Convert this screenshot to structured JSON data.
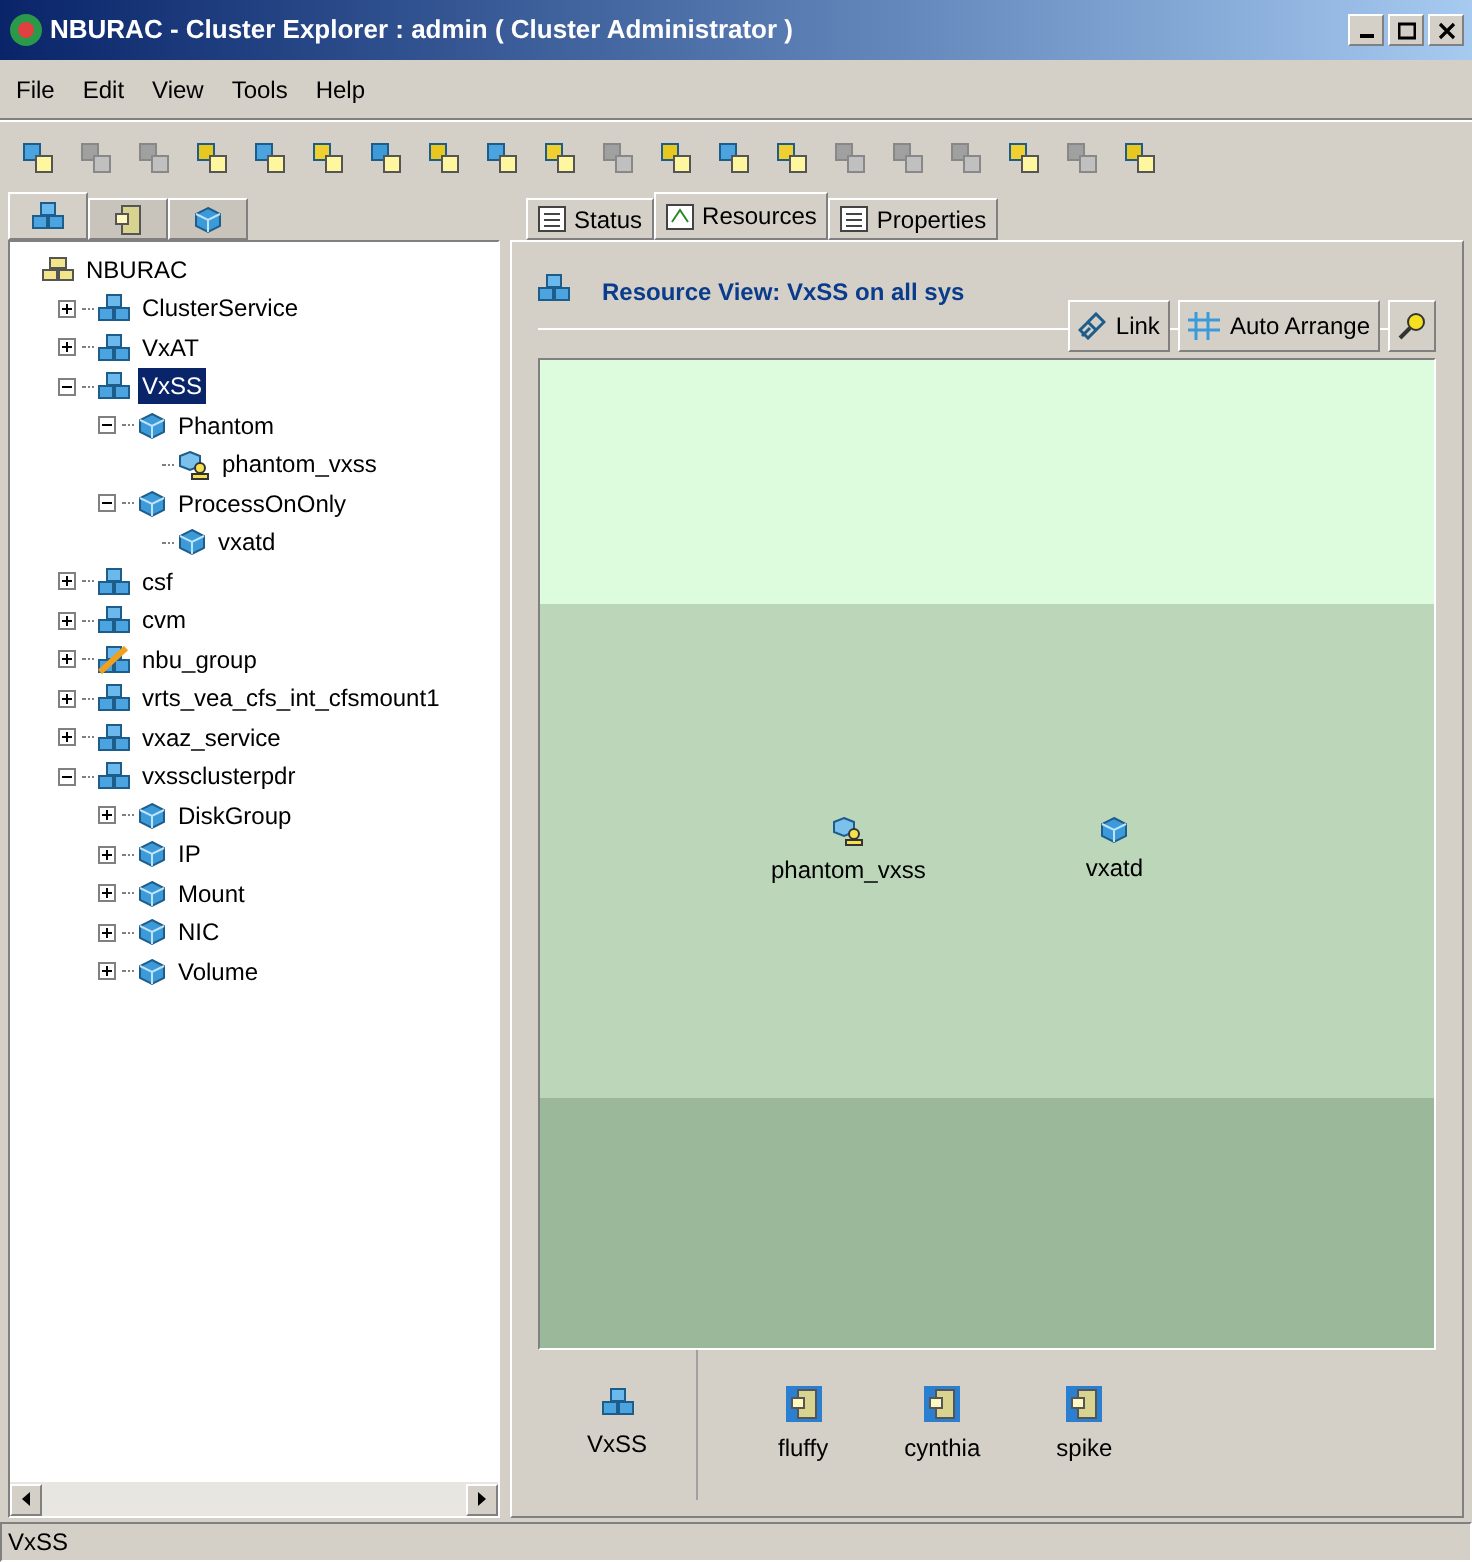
{
  "window": {
    "title": "NBURAC - Cluster Explorer : admin ( Cluster Administrator )"
  },
  "menu": [
    "File",
    "Edit",
    "View",
    "Tools",
    "Help"
  ],
  "toolbar": [
    {
      "disabled": false
    },
    {
      "disabled": true
    },
    {
      "disabled": true
    },
    {
      "disabled": false
    },
    {
      "disabled": false
    },
    {
      "disabled": false
    },
    {
      "disabled": false
    },
    {
      "disabled": false
    },
    {
      "disabled": false
    },
    {
      "disabled": false
    },
    {
      "disabled": true
    },
    {
      "disabled": false
    },
    {
      "disabled": false
    },
    {
      "disabled": false
    },
    {
      "disabled": true
    },
    {
      "disabled": true
    },
    {
      "disabled": true
    },
    {
      "disabled": false
    },
    {
      "disabled": true
    },
    {
      "disabled": false
    }
  ],
  "left_tabs": [
    {
      "kind": "group",
      "selected": true
    },
    {
      "kind": "system",
      "selected": false
    },
    {
      "kind": "type",
      "selected": false
    }
  ],
  "tree": {
    "label": "NBURAC",
    "kind": "cluster",
    "selected": false,
    "children": [
      {
        "label": "ClusterService",
        "kind": "group",
        "selected": false,
        "expanded": false
      },
      {
        "label": "VxAT",
        "kind": "group",
        "selected": false,
        "expanded": false
      },
      {
        "label": "VxSS",
        "kind": "group",
        "selected": true,
        "expanded": true,
        "children": [
          {
            "label": "Phantom",
            "kind": "type",
            "selected": false,
            "expanded": true,
            "children": [
              {
                "label": "phantom_vxss",
                "kind": "phantom",
                "selected": false
              }
            ]
          },
          {
            "label": "ProcessOnOnly",
            "kind": "type",
            "selected": false,
            "expanded": true,
            "children": [
              {
                "label": "vxatd",
                "kind": "resource",
                "selected": false
              }
            ]
          }
        ]
      },
      {
        "label": "csf",
        "kind": "group",
        "selected": false,
        "expanded": false
      },
      {
        "label": "cvm",
        "kind": "group",
        "selected": false,
        "expanded": false
      },
      {
        "label": "nbu_group",
        "kind": "faulted",
        "selected": false,
        "expanded": false
      },
      {
        "label": "vrts_vea_cfs_int_cfsmount1",
        "kind": "group",
        "selected": false,
        "expanded": false
      },
      {
        "label": "vxaz_service",
        "kind": "group",
        "selected": false,
        "expanded": false
      },
      {
        "label": "vxssclusterpdr",
        "kind": "group",
        "selected": false,
        "expanded": true,
        "children": [
          {
            "label": "DiskGroup",
            "kind": "type",
            "selected": false,
            "expanded": false
          },
          {
            "label": "IP",
            "kind": "type",
            "selected": false,
            "expanded": false
          },
          {
            "label": "Mount",
            "kind": "type",
            "selected": false,
            "expanded": false
          },
          {
            "label": "NIC",
            "kind": "type",
            "selected": false,
            "expanded": false
          },
          {
            "label": "Volume",
            "kind": "type",
            "selected": false,
            "expanded": false
          }
        ]
      }
    ]
  },
  "tabs": [
    {
      "label": "Status",
      "selected": false
    },
    {
      "label": "Resources",
      "selected": true
    },
    {
      "label": "Properties",
      "selected": false
    }
  ],
  "view_title": "Resource View: VxSS on all sys",
  "view_buttons": [
    {
      "label": "Link",
      "kind": "link"
    },
    {
      "label": "Auto Arrange",
      "kind": "arrange"
    },
    {
      "kind": "find"
    }
  ],
  "graph_nodes": [
    {
      "label": "phantom_vxss",
      "kind": "phantom"
    },
    {
      "label": "vxatd",
      "kind": "resource"
    }
  ],
  "group": {
    "label": "VxSS"
  },
  "systems": [
    "fluffy",
    "cynthia",
    "spike"
  ],
  "status_bar": "VxSS"
}
